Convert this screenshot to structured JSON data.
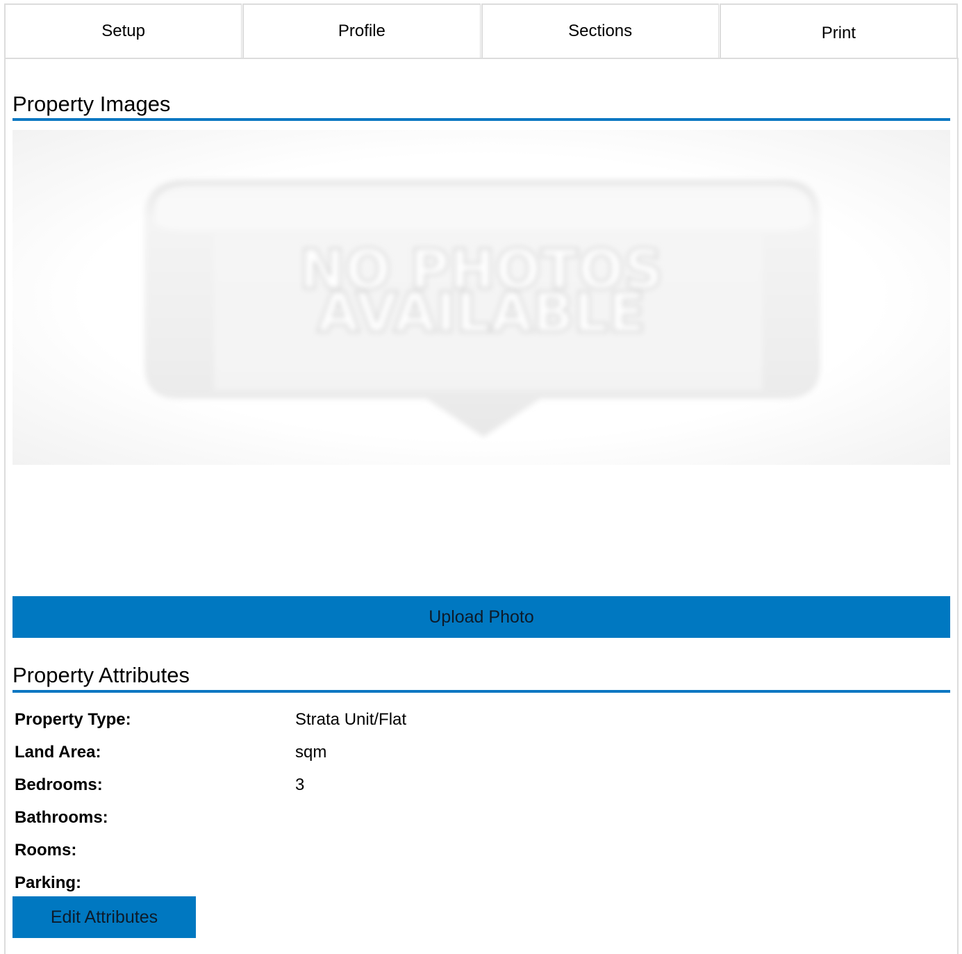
{
  "tabs": [
    {
      "label": "Setup"
    },
    {
      "label": "Profile"
    },
    {
      "label": "Sections"
    },
    {
      "label": "Print"
    }
  ],
  "images_section": {
    "title": "Property Images",
    "placeholder_line1": "NO PHOTOS",
    "placeholder_line2": "AVAILABLE",
    "upload_label": "Upload Photo"
  },
  "attributes_section": {
    "title": "Property Attributes",
    "rows": [
      {
        "label": "Property Type:",
        "value": "Strata Unit/Flat"
      },
      {
        "label": "Land Area:",
        "value": "sqm"
      },
      {
        "label": "Bedrooms:",
        "value": "3"
      },
      {
        "label": "Bathrooms:",
        "value": ""
      },
      {
        "label": "Rooms:",
        "value": ""
      },
      {
        "label": "Parking:",
        "value": ""
      }
    ],
    "edit_label": "Edit Attributes"
  },
  "colors": {
    "accent": "#0078c1",
    "rule": "#0a77c2",
    "tab_border": "#dcdcdc"
  }
}
